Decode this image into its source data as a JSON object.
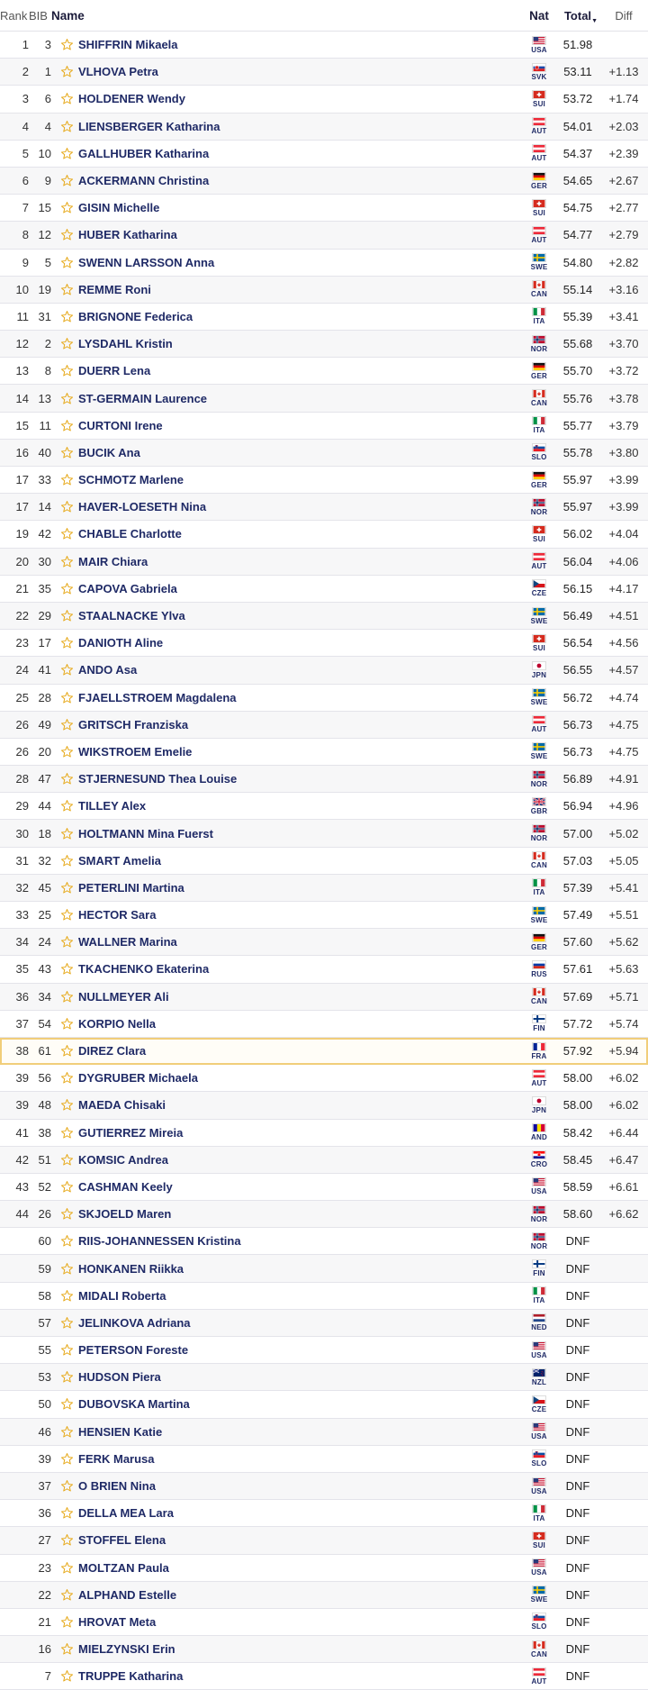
{
  "header": {
    "rank": "Rank",
    "bib": "BIB",
    "name": "Name",
    "nat": "Nat",
    "total": "Total",
    "diff": "Diff"
  },
  "colors": {
    "highlight_border": "#f1ce7a",
    "name_text": "#1f2a66",
    "star": "#e6a817"
  },
  "rows": [
    {
      "rank": "1",
      "bib": "3",
      "name": "SHIFFRIN Mikaela",
      "nat": "USA",
      "total": "51.98",
      "diff": ""
    },
    {
      "rank": "2",
      "bib": "1",
      "name": "VLHOVA Petra",
      "nat": "SVK",
      "total": "53.11",
      "diff": "+1.13"
    },
    {
      "rank": "3",
      "bib": "6",
      "name": "HOLDENER Wendy",
      "nat": "SUI",
      "total": "53.72",
      "diff": "+1.74"
    },
    {
      "rank": "4",
      "bib": "4",
      "name": "LIENSBERGER Katharina",
      "nat": "AUT",
      "total": "54.01",
      "diff": "+2.03"
    },
    {
      "rank": "5",
      "bib": "10",
      "name": "GALLHUBER Katharina",
      "nat": "AUT",
      "total": "54.37",
      "diff": "+2.39"
    },
    {
      "rank": "6",
      "bib": "9",
      "name": "ACKERMANN Christina",
      "nat": "GER",
      "total": "54.65",
      "diff": "+2.67"
    },
    {
      "rank": "7",
      "bib": "15",
      "name": "GISIN Michelle",
      "nat": "SUI",
      "total": "54.75",
      "diff": "+2.77"
    },
    {
      "rank": "8",
      "bib": "12",
      "name": "HUBER Katharina",
      "nat": "AUT",
      "total": "54.77",
      "diff": "+2.79"
    },
    {
      "rank": "9",
      "bib": "5",
      "name": "SWENN LARSSON Anna",
      "nat": "SWE",
      "total": "54.80",
      "diff": "+2.82"
    },
    {
      "rank": "10",
      "bib": "19",
      "name": "REMME Roni",
      "nat": "CAN",
      "total": "55.14",
      "diff": "+3.16"
    },
    {
      "rank": "11",
      "bib": "31",
      "name": "BRIGNONE Federica",
      "nat": "ITA",
      "total": "55.39",
      "diff": "+3.41"
    },
    {
      "rank": "12",
      "bib": "2",
      "name": "LYSDAHL Kristin",
      "nat": "NOR",
      "total": "55.68",
      "diff": "+3.70"
    },
    {
      "rank": "13",
      "bib": "8",
      "name": "DUERR Lena",
      "nat": "GER",
      "total": "55.70",
      "diff": "+3.72"
    },
    {
      "rank": "14",
      "bib": "13",
      "name": "ST-GERMAIN Laurence",
      "nat": "CAN",
      "total": "55.76",
      "diff": "+3.78"
    },
    {
      "rank": "15",
      "bib": "11",
      "name": "CURTONI Irene",
      "nat": "ITA",
      "total": "55.77",
      "diff": "+3.79"
    },
    {
      "rank": "16",
      "bib": "40",
      "name": "BUCIK Ana",
      "nat": "SLO",
      "total": "55.78",
      "diff": "+3.80"
    },
    {
      "rank": "17",
      "bib": "33",
      "name": "SCHMOTZ Marlene",
      "nat": "GER",
      "total": "55.97",
      "diff": "+3.99"
    },
    {
      "rank": "17",
      "bib": "14",
      "name": "HAVER-LOESETH Nina",
      "nat": "NOR",
      "total": "55.97",
      "diff": "+3.99"
    },
    {
      "rank": "19",
      "bib": "42",
      "name": "CHABLE Charlotte",
      "nat": "SUI",
      "total": "56.02",
      "diff": "+4.04"
    },
    {
      "rank": "20",
      "bib": "30",
      "name": "MAIR Chiara",
      "nat": "AUT",
      "total": "56.04",
      "diff": "+4.06"
    },
    {
      "rank": "21",
      "bib": "35",
      "name": "CAPOVA Gabriela",
      "nat": "CZE",
      "total": "56.15",
      "diff": "+4.17"
    },
    {
      "rank": "22",
      "bib": "29",
      "name": "STAALNACKE Ylva",
      "nat": "SWE",
      "total": "56.49",
      "diff": "+4.51"
    },
    {
      "rank": "23",
      "bib": "17",
      "name": "DANIOTH Aline",
      "nat": "SUI",
      "total": "56.54",
      "diff": "+4.56"
    },
    {
      "rank": "24",
      "bib": "41",
      "name": "ANDO Asa",
      "nat": "JPN",
      "total": "56.55",
      "diff": "+4.57"
    },
    {
      "rank": "25",
      "bib": "28",
      "name": "FJAELLSTROEM Magdalena",
      "nat": "SWE",
      "total": "56.72",
      "diff": "+4.74"
    },
    {
      "rank": "26",
      "bib": "49",
      "name": "GRITSCH Franziska",
      "nat": "AUT",
      "total": "56.73",
      "diff": "+4.75"
    },
    {
      "rank": "26",
      "bib": "20",
      "name": "WIKSTROEM Emelie",
      "nat": "SWE",
      "total": "56.73",
      "diff": "+4.75"
    },
    {
      "rank": "28",
      "bib": "47",
      "name": "STJERNESUND Thea Louise",
      "nat": "NOR",
      "total": "56.89",
      "diff": "+4.91"
    },
    {
      "rank": "29",
      "bib": "44",
      "name": "TILLEY Alex",
      "nat": "GBR",
      "total": "56.94",
      "diff": "+4.96"
    },
    {
      "rank": "30",
      "bib": "18",
      "name": "HOLTMANN Mina Fuerst",
      "nat": "NOR",
      "total": "57.00",
      "diff": "+5.02"
    },
    {
      "rank": "31",
      "bib": "32",
      "name": "SMART Amelia",
      "nat": "CAN",
      "total": "57.03",
      "diff": "+5.05"
    },
    {
      "rank": "32",
      "bib": "45",
      "name": "PETERLINI Martina",
      "nat": "ITA",
      "total": "57.39",
      "diff": "+5.41"
    },
    {
      "rank": "33",
      "bib": "25",
      "name": "HECTOR Sara",
      "nat": "SWE",
      "total": "57.49",
      "diff": "+5.51"
    },
    {
      "rank": "34",
      "bib": "24",
      "name": "WALLNER Marina",
      "nat": "GER",
      "total": "57.60",
      "diff": "+5.62"
    },
    {
      "rank": "35",
      "bib": "43",
      "name": "TKACHENKO Ekaterina",
      "nat": "RUS",
      "total": "57.61",
      "diff": "+5.63"
    },
    {
      "rank": "36",
      "bib": "34",
      "name": "NULLMEYER Ali",
      "nat": "CAN",
      "total": "57.69",
      "diff": "+5.71"
    },
    {
      "rank": "37",
      "bib": "54",
      "name": "KORPIO Nella",
      "nat": "FIN",
      "total": "57.72",
      "diff": "+5.74"
    },
    {
      "rank": "38",
      "bib": "61",
      "name": "DIREZ Clara",
      "nat": "FRA",
      "total": "57.92",
      "diff": "+5.94",
      "highlight": true
    },
    {
      "rank": "39",
      "bib": "56",
      "name": "DYGRUBER Michaela",
      "nat": "AUT",
      "total": "58.00",
      "diff": "+6.02"
    },
    {
      "rank": "39",
      "bib": "48",
      "name": "MAEDA Chisaki",
      "nat": "JPN",
      "total": "58.00",
      "diff": "+6.02"
    },
    {
      "rank": "41",
      "bib": "38",
      "name": "GUTIERREZ Mireia",
      "nat": "AND",
      "total": "58.42",
      "diff": "+6.44"
    },
    {
      "rank": "42",
      "bib": "51",
      "name": "KOMSIC Andrea",
      "nat": "CRO",
      "total": "58.45",
      "diff": "+6.47"
    },
    {
      "rank": "43",
      "bib": "52",
      "name": "CASHMAN Keely",
      "nat": "USA",
      "total": "58.59",
      "diff": "+6.61"
    },
    {
      "rank": "44",
      "bib": "26",
      "name": "SKJOELD Maren",
      "nat": "NOR",
      "total": "58.60",
      "diff": "+6.62"
    },
    {
      "rank": "",
      "bib": "60",
      "name": "RIIS-JOHANNESSEN Kristina",
      "nat": "NOR",
      "total": "DNF",
      "diff": ""
    },
    {
      "rank": "",
      "bib": "59",
      "name": "HONKANEN Riikka",
      "nat": "FIN",
      "total": "DNF",
      "diff": ""
    },
    {
      "rank": "",
      "bib": "58",
      "name": "MIDALI Roberta",
      "nat": "ITA",
      "total": "DNF",
      "diff": ""
    },
    {
      "rank": "",
      "bib": "57",
      "name": "JELINKOVA Adriana",
      "nat": "NED",
      "total": "DNF",
      "diff": ""
    },
    {
      "rank": "",
      "bib": "55",
      "name": "PETERSON Foreste",
      "nat": "USA",
      "total": "DNF",
      "diff": ""
    },
    {
      "rank": "",
      "bib": "53",
      "name": "HUDSON Piera",
      "nat": "NZL",
      "total": "DNF",
      "diff": ""
    },
    {
      "rank": "",
      "bib": "50",
      "name": "DUBOVSKA Martina",
      "nat": "CZE",
      "total": "DNF",
      "diff": ""
    },
    {
      "rank": "",
      "bib": "46",
      "name": "HENSIEN Katie",
      "nat": "USA",
      "total": "DNF",
      "diff": ""
    },
    {
      "rank": "",
      "bib": "39",
      "name": "FERK Marusa",
      "nat": "SLO",
      "total": "DNF",
      "diff": ""
    },
    {
      "rank": "",
      "bib": "37",
      "name": "O BRIEN Nina",
      "nat": "USA",
      "total": "DNF",
      "diff": ""
    },
    {
      "rank": "",
      "bib": "36",
      "name": "DELLA MEA Lara",
      "nat": "ITA",
      "total": "DNF",
      "diff": ""
    },
    {
      "rank": "",
      "bib": "27",
      "name": "STOFFEL Elena",
      "nat": "SUI",
      "total": "DNF",
      "diff": ""
    },
    {
      "rank": "",
      "bib": "23",
      "name": "MOLTZAN Paula",
      "nat": "USA",
      "total": "DNF",
      "diff": ""
    },
    {
      "rank": "",
      "bib": "22",
      "name": "ALPHAND Estelle",
      "nat": "SWE",
      "total": "DNF",
      "diff": ""
    },
    {
      "rank": "",
      "bib": "21",
      "name": "HROVAT Meta",
      "nat": "SLO",
      "total": "DNF",
      "diff": ""
    },
    {
      "rank": "",
      "bib": "16",
      "name": "MIELZYNSKI Erin",
      "nat": "CAN",
      "total": "DNF",
      "diff": ""
    },
    {
      "rank": "",
      "bib": "7",
      "name": "TRUPPE Katharina",
      "nat": "AUT",
      "total": "DNF",
      "diff": ""
    }
  ]
}
